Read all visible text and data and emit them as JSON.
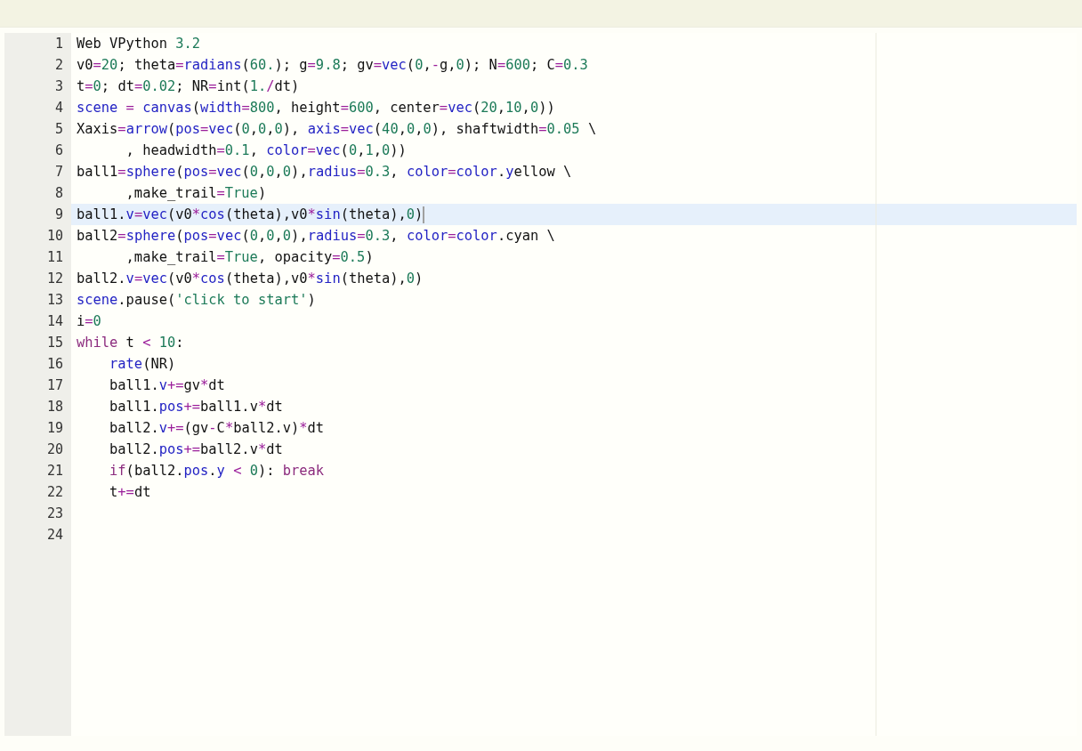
{
  "editor": {
    "lines": [
      {
        "number": "1",
        "current": false,
        "tokens": [
          {
            "kind": "name",
            "text": "Web VPython "
          },
          {
            "kind": "num",
            "text": "3.2"
          }
        ]
      },
      {
        "number": "2",
        "current": false,
        "tokens": [
          {
            "kind": "name",
            "text": "v0"
          },
          {
            "kind": "op",
            "text": "="
          },
          {
            "kind": "num",
            "text": "20"
          },
          {
            "kind": "name",
            "text": "; theta"
          },
          {
            "kind": "op",
            "text": "="
          },
          {
            "kind": "call",
            "text": "radians"
          },
          {
            "kind": "name",
            "text": "("
          },
          {
            "kind": "num",
            "text": "60."
          },
          {
            "kind": "name",
            "text": "); g"
          },
          {
            "kind": "op",
            "text": "="
          },
          {
            "kind": "num",
            "text": "9.8"
          },
          {
            "kind": "name",
            "text": "; gv"
          },
          {
            "kind": "op",
            "text": "="
          },
          {
            "kind": "call",
            "text": "vec"
          },
          {
            "kind": "name",
            "text": "("
          },
          {
            "kind": "num",
            "text": "0"
          },
          {
            "kind": "name",
            "text": ","
          },
          {
            "kind": "op",
            "text": "-"
          },
          {
            "kind": "name",
            "text": "g,"
          },
          {
            "kind": "num",
            "text": "0"
          },
          {
            "kind": "name",
            "text": "); N"
          },
          {
            "kind": "op",
            "text": "="
          },
          {
            "kind": "num",
            "text": "600"
          },
          {
            "kind": "name",
            "text": "; C"
          },
          {
            "kind": "op",
            "text": "="
          },
          {
            "kind": "num",
            "text": "0.3"
          }
        ]
      },
      {
        "number": "3",
        "current": false,
        "tokens": [
          {
            "kind": "name",
            "text": "t"
          },
          {
            "kind": "op",
            "text": "="
          },
          {
            "kind": "num",
            "text": "0"
          },
          {
            "kind": "name",
            "text": "; dt"
          },
          {
            "kind": "op",
            "text": "="
          },
          {
            "kind": "num",
            "text": "0.02"
          },
          {
            "kind": "name",
            "text": "; NR"
          },
          {
            "kind": "op",
            "text": "="
          },
          {
            "kind": "name",
            "text": "int("
          },
          {
            "kind": "num",
            "text": "1."
          },
          {
            "kind": "op",
            "text": "/"
          },
          {
            "kind": "name",
            "text": "dt)"
          }
        ]
      },
      {
        "number": "4",
        "current": false,
        "tokens": [
          {
            "kind": "call",
            "text": "scene"
          },
          {
            "kind": "op",
            "text": " = "
          },
          {
            "kind": "call",
            "text": "canvas"
          },
          {
            "kind": "name",
            "text": "("
          },
          {
            "kind": "call",
            "text": "width"
          },
          {
            "kind": "op",
            "text": "="
          },
          {
            "kind": "num",
            "text": "800"
          },
          {
            "kind": "name",
            "text": ", height"
          },
          {
            "kind": "op",
            "text": "="
          },
          {
            "kind": "num",
            "text": "600"
          },
          {
            "kind": "name",
            "text": ", center"
          },
          {
            "kind": "op",
            "text": "="
          },
          {
            "kind": "call",
            "text": "vec"
          },
          {
            "kind": "name",
            "text": "("
          },
          {
            "kind": "num",
            "text": "20"
          },
          {
            "kind": "name",
            "text": ","
          },
          {
            "kind": "num",
            "text": "10"
          },
          {
            "kind": "name",
            "text": ","
          },
          {
            "kind": "num",
            "text": "0"
          },
          {
            "kind": "name",
            "text": "))"
          }
        ]
      },
      {
        "number": "5",
        "current": false,
        "tokens": [
          {
            "kind": "name",
            "text": "Xaxis"
          },
          {
            "kind": "op",
            "text": "="
          },
          {
            "kind": "call",
            "text": "arrow"
          },
          {
            "kind": "name",
            "text": "("
          },
          {
            "kind": "call",
            "text": "pos"
          },
          {
            "kind": "op",
            "text": "="
          },
          {
            "kind": "call",
            "text": "vec"
          },
          {
            "kind": "name",
            "text": "("
          },
          {
            "kind": "num",
            "text": "0"
          },
          {
            "kind": "name",
            "text": ","
          },
          {
            "kind": "num",
            "text": "0"
          },
          {
            "kind": "name",
            "text": ","
          },
          {
            "kind": "num",
            "text": "0"
          },
          {
            "kind": "name",
            "text": "), "
          },
          {
            "kind": "call",
            "text": "axis"
          },
          {
            "kind": "op",
            "text": "="
          },
          {
            "kind": "call",
            "text": "vec"
          },
          {
            "kind": "name",
            "text": "("
          },
          {
            "kind": "num",
            "text": "40"
          },
          {
            "kind": "name",
            "text": ","
          },
          {
            "kind": "num",
            "text": "0"
          },
          {
            "kind": "name",
            "text": ","
          },
          {
            "kind": "num",
            "text": "0"
          },
          {
            "kind": "name",
            "text": "), shaftwidth"
          },
          {
            "kind": "op",
            "text": "="
          },
          {
            "kind": "num",
            "text": "0.05"
          },
          {
            "kind": "name",
            "text": " \\"
          }
        ]
      },
      {
        "number": "6",
        "current": false,
        "tokens": [
          {
            "kind": "name",
            "text": "      , headwidth"
          },
          {
            "kind": "op",
            "text": "="
          },
          {
            "kind": "num",
            "text": "0.1"
          },
          {
            "kind": "name",
            "text": ", "
          },
          {
            "kind": "call",
            "text": "color"
          },
          {
            "kind": "op",
            "text": "="
          },
          {
            "kind": "call",
            "text": "vec"
          },
          {
            "kind": "name",
            "text": "("
          },
          {
            "kind": "num",
            "text": "0"
          },
          {
            "kind": "name",
            "text": ","
          },
          {
            "kind": "num",
            "text": "1"
          },
          {
            "kind": "name",
            "text": ","
          },
          {
            "kind": "num",
            "text": "0"
          },
          {
            "kind": "name",
            "text": "))"
          }
        ]
      },
      {
        "number": "7",
        "current": false,
        "tokens": [
          {
            "kind": "name",
            "text": "ball1"
          },
          {
            "kind": "op",
            "text": "="
          },
          {
            "kind": "call",
            "text": "sphere"
          },
          {
            "kind": "name",
            "text": "("
          },
          {
            "kind": "call",
            "text": "pos"
          },
          {
            "kind": "op",
            "text": "="
          },
          {
            "kind": "call",
            "text": "vec"
          },
          {
            "kind": "name",
            "text": "("
          },
          {
            "kind": "num",
            "text": "0"
          },
          {
            "kind": "name",
            "text": ","
          },
          {
            "kind": "num",
            "text": "0"
          },
          {
            "kind": "name",
            "text": ","
          },
          {
            "kind": "num",
            "text": "0"
          },
          {
            "kind": "name",
            "text": "),"
          },
          {
            "kind": "call",
            "text": "radius"
          },
          {
            "kind": "op",
            "text": "="
          },
          {
            "kind": "num",
            "text": "0.3"
          },
          {
            "kind": "name",
            "text": ", "
          },
          {
            "kind": "call",
            "text": "color"
          },
          {
            "kind": "op",
            "text": "="
          },
          {
            "kind": "call",
            "text": "color"
          },
          {
            "kind": "name",
            "text": "."
          },
          {
            "kind": "call",
            "text": "y"
          },
          {
            "kind": "name",
            "text": "ellow \\"
          }
        ]
      },
      {
        "number": "8",
        "current": false,
        "tokens": [
          {
            "kind": "name",
            "text": "      ,make_trail"
          },
          {
            "kind": "op",
            "text": "="
          },
          {
            "kind": "num",
            "text": "True"
          },
          {
            "kind": "name",
            "text": ")"
          }
        ]
      },
      {
        "number": "9",
        "current": true,
        "tokens": [
          {
            "kind": "name",
            "text": "ball1."
          },
          {
            "kind": "call",
            "text": "v"
          },
          {
            "kind": "op",
            "text": "="
          },
          {
            "kind": "call",
            "text": "vec"
          },
          {
            "kind": "name",
            "text": "(v0"
          },
          {
            "kind": "op",
            "text": "*"
          },
          {
            "kind": "call",
            "text": "cos"
          },
          {
            "kind": "name",
            "text": "(theta),v0"
          },
          {
            "kind": "op",
            "text": "*"
          },
          {
            "kind": "call",
            "text": "sin"
          },
          {
            "kind": "name",
            "text": "(theta),"
          },
          {
            "kind": "num",
            "text": "0"
          },
          {
            "kind": "name",
            "text": ")"
          }
        ]
      },
      {
        "number": "10",
        "current": false,
        "tokens": [
          {
            "kind": "name",
            "text": "ball2"
          },
          {
            "kind": "op",
            "text": "="
          },
          {
            "kind": "call",
            "text": "sphere"
          },
          {
            "kind": "name",
            "text": "("
          },
          {
            "kind": "call",
            "text": "pos"
          },
          {
            "kind": "op",
            "text": "="
          },
          {
            "kind": "call",
            "text": "vec"
          },
          {
            "kind": "name",
            "text": "("
          },
          {
            "kind": "num",
            "text": "0"
          },
          {
            "kind": "name",
            "text": ","
          },
          {
            "kind": "num",
            "text": "0"
          },
          {
            "kind": "name",
            "text": ","
          },
          {
            "kind": "num",
            "text": "0"
          },
          {
            "kind": "name",
            "text": "),"
          },
          {
            "kind": "call",
            "text": "radius"
          },
          {
            "kind": "op",
            "text": "="
          },
          {
            "kind": "num",
            "text": "0.3"
          },
          {
            "kind": "name",
            "text": ", "
          },
          {
            "kind": "call",
            "text": "color"
          },
          {
            "kind": "op",
            "text": "="
          },
          {
            "kind": "call",
            "text": "color"
          },
          {
            "kind": "name",
            "text": ".cyan \\"
          }
        ]
      },
      {
        "number": "11",
        "current": false,
        "tokens": [
          {
            "kind": "name",
            "text": "      ,make_trail"
          },
          {
            "kind": "op",
            "text": "="
          },
          {
            "kind": "num",
            "text": "True"
          },
          {
            "kind": "name",
            "text": ", opacity"
          },
          {
            "kind": "op",
            "text": "="
          },
          {
            "kind": "num",
            "text": "0.5"
          },
          {
            "kind": "name",
            "text": ")"
          }
        ]
      },
      {
        "number": "12",
        "current": false,
        "tokens": [
          {
            "kind": "name",
            "text": "ball2."
          },
          {
            "kind": "call",
            "text": "v"
          },
          {
            "kind": "op",
            "text": "="
          },
          {
            "kind": "call",
            "text": "vec"
          },
          {
            "kind": "name",
            "text": "(v0"
          },
          {
            "kind": "op",
            "text": "*"
          },
          {
            "kind": "call",
            "text": "cos"
          },
          {
            "kind": "name",
            "text": "(theta),v0"
          },
          {
            "kind": "op",
            "text": "*"
          },
          {
            "kind": "call",
            "text": "sin"
          },
          {
            "kind": "name",
            "text": "(theta),"
          },
          {
            "kind": "num",
            "text": "0"
          },
          {
            "kind": "name",
            "text": ")"
          }
        ]
      },
      {
        "number": "13",
        "current": false,
        "tokens": [
          {
            "kind": "call",
            "text": "scene"
          },
          {
            "kind": "name",
            "text": ".pause("
          },
          {
            "kind": "str",
            "text": "'click to start'"
          },
          {
            "kind": "name",
            "text": ")"
          }
        ]
      },
      {
        "number": "14",
        "current": false,
        "tokens": [
          {
            "kind": "name",
            "text": "i"
          },
          {
            "kind": "op",
            "text": "="
          },
          {
            "kind": "num",
            "text": "0"
          }
        ]
      },
      {
        "number": "15",
        "current": false,
        "tokens": [
          {
            "kind": "kw",
            "text": "while"
          },
          {
            "kind": "name",
            "text": " t "
          },
          {
            "kind": "op",
            "text": "< "
          },
          {
            "kind": "num",
            "text": "10"
          },
          {
            "kind": "name",
            "text": ":"
          }
        ]
      },
      {
        "number": "16",
        "current": false,
        "tokens": [
          {
            "kind": "call",
            "text": "    rate"
          },
          {
            "kind": "name",
            "text": "(NR)"
          }
        ]
      },
      {
        "number": "17",
        "current": false,
        "tokens": [
          {
            "kind": "name",
            "text": "    ball1."
          },
          {
            "kind": "call",
            "text": "v"
          },
          {
            "kind": "op",
            "text": "+="
          },
          {
            "kind": "name",
            "text": "gv"
          },
          {
            "kind": "op",
            "text": "*"
          },
          {
            "kind": "name",
            "text": "dt"
          }
        ]
      },
      {
        "number": "18",
        "current": false,
        "tokens": [
          {
            "kind": "name",
            "text": "    ball1."
          },
          {
            "kind": "call",
            "text": "pos"
          },
          {
            "kind": "op",
            "text": "+="
          },
          {
            "kind": "name",
            "text": "ball1.v"
          },
          {
            "kind": "op",
            "text": "*"
          },
          {
            "kind": "name",
            "text": "dt"
          }
        ]
      },
      {
        "number": "19",
        "current": false,
        "tokens": [
          {
            "kind": "name",
            "text": "    ball2."
          },
          {
            "kind": "call",
            "text": "v"
          },
          {
            "kind": "op",
            "text": "+="
          },
          {
            "kind": "name",
            "text": "(gv"
          },
          {
            "kind": "op",
            "text": "-"
          },
          {
            "kind": "name",
            "text": "C"
          },
          {
            "kind": "op",
            "text": "*"
          },
          {
            "kind": "name",
            "text": "ball2.v)"
          },
          {
            "kind": "op",
            "text": "*"
          },
          {
            "kind": "name",
            "text": "dt"
          }
        ]
      },
      {
        "number": "20",
        "current": false,
        "tokens": [
          {
            "kind": "name",
            "text": "    ball2."
          },
          {
            "kind": "call",
            "text": "pos"
          },
          {
            "kind": "op",
            "text": "+="
          },
          {
            "kind": "name",
            "text": "ball2.v"
          },
          {
            "kind": "op",
            "text": "*"
          },
          {
            "kind": "name",
            "text": "dt"
          }
        ]
      },
      {
        "number": "21",
        "current": false,
        "tokens": [
          {
            "kind": "kw",
            "text": "    if"
          },
          {
            "kind": "name",
            "text": "(ball2."
          },
          {
            "kind": "call",
            "text": "pos"
          },
          {
            "kind": "name",
            "text": "."
          },
          {
            "kind": "call",
            "text": "y"
          },
          {
            "kind": "op",
            "text": " < "
          },
          {
            "kind": "num",
            "text": "0"
          },
          {
            "kind": "name",
            "text": "): "
          },
          {
            "kind": "kw",
            "text": "break"
          }
        ]
      },
      {
        "number": "22",
        "current": false,
        "tokens": [
          {
            "kind": "name",
            "text": "    t"
          },
          {
            "kind": "op",
            "text": "+="
          },
          {
            "kind": "name",
            "text": "dt"
          }
        ]
      },
      {
        "number": "23",
        "current": false
      },
      {
        "number": "24",
        "current": false
      }
    ]
  }
}
